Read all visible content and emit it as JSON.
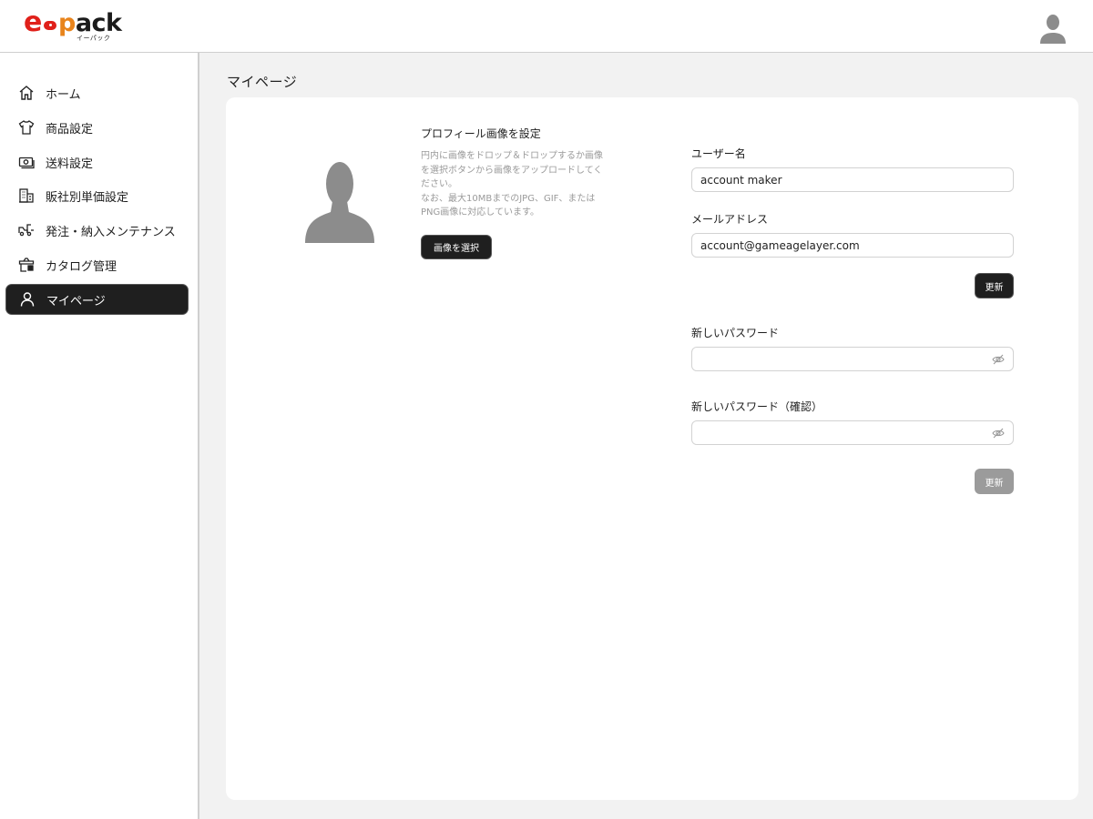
{
  "logo": {
    "brand_e": "e",
    "brand_name": "pack",
    "brand_p": "p",
    "brand_rest": "ack",
    "subtitle": "イーパック",
    "brand_color": "#e0201a",
    "accent_color": "#e8841c"
  },
  "header": {
    "avatar_icon": "user-avatar-icon"
  },
  "sidebar": {
    "items": [
      {
        "label": "ホーム",
        "icon": "home-icon",
        "active": false
      },
      {
        "label": "商品設定",
        "icon": "tshirt-icon",
        "active": false
      },
      {
        "label": "送料設定",
        "icon": "money-icon",
        "active": false
      },
      {
        "label": "販社別単価設定",
        "icon": "building-icon",
        "active": false
      },
      {
        "label": "発注・納入メンテナンス",
        "icon": "truck-icon",
        "active": false
      },
      {
        "label": "カタログ管理",
        "icon": "catalog-icon",
        "active": false
      },
      {
        "label": "マイページ",
        "icon": "person-icon",
        "active": true
      }
    ]
  },
  "main": {
    "page_title": "マイページ",
    "profile": {
      "title": "プロフィール画像を設定",
      "description_lines": [
        "円内に画像をドロップ＆ドロップするか画像",
        "を選択ボタンから画像をアップロードしてく",
        "ださい。",
        "なお、最大10MBまでのJPG、GIF、または",
        "PNG画像に対応しています。"
      ],
      "select_button": "画像を選択"
    },
    "account": {
      "username_label": "ユーザー名",
      "username_value": "account maker",
      "email_label": "メールアドレス",
      "email_value": "account@gameagelayer.com",
      "update_button": "更新"
    },
    "password": {
      "new_label": "新しいパスワード",
      "new_value": "",
      "confirm_label": "新しいパスワード（確認）",
      "confirm_value": "",
      "update_button": "更新",
      "update_enabled": false
    }
  },
  "colors": {
    "dark_button": "#1f1f1f",
    "disabled_button": "#9b9b9b",
    "page_bg": "#f2f2f2"
  }
}
